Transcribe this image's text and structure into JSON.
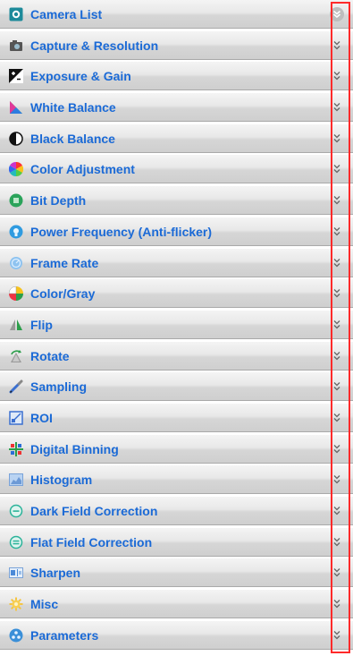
{
  "sections": [
    {
      "label": "Camera List",
      "icon": "camera-list-icon",
      "expanded": true
    },
    {
      "label": "Capture & Resolution",
      "icon": "capture-camera-icon"
    },
    {
      "label": "Exposure & Gain",
      "icon": "exposure-icon"
    },
    {
      "label": "White Balance",
      "icon": "white-balance-icon"
    },
    {
      "label": "Black Balance",
      "icon": "black-balance-icon"
    },
    {
      "label": "Color Adjustment",
      "icon": "color-wheel-icon"
    },
    {
      "label": "Bit Depth",
      "icon": "bit-depth-icon"
    },
    {
      "label": "Power Frequency (Anti-flicker)",
      "icon": "power-frequency-icon"
    },
    {
      "label": "Frame Rate",
      "icon": "frame-rate-icon"
    },
    {
      "label": "Color/Gray",
      "icon": "color-gray-icon"
    },
    {
      "label": "Flip",
      "icon": "flip-icon"
    },
    {
      "label": "Rotate",
      "icon": "rotate-icon"
    },
    {
      "label": "Sampling",
      "icon": "sampling-pen-icon"
    },
    {
      "label": "ROI",
      "icon": "roi-icon"
    },
    {
      "label": "Digital Binning",
      "icon": "digital-binning-icon"
    },
    {
      "label": "Histogram",
      "icon": "histogram-icon"
    },
    {
      "label": "Dark Field Correction",
      "icon": "dark-field-icon"
    },
    {
      "label": "Flat Field Correction",
      "icon": "flat-field-icon"
    },
    {
      "label": "Sharpen",
      "icon": "sharpen-icon"
    },
    {
      "label": "Misc",
      "icon": "misc-gear-icon"
    },
    {
      "label": "Parameters",
      "icon": "parameters-icon"
    }
  ],
  "colors": {
    "label": "#1b6ad6",
    "highlight_frame": "#ff2a2a"
  }
}
